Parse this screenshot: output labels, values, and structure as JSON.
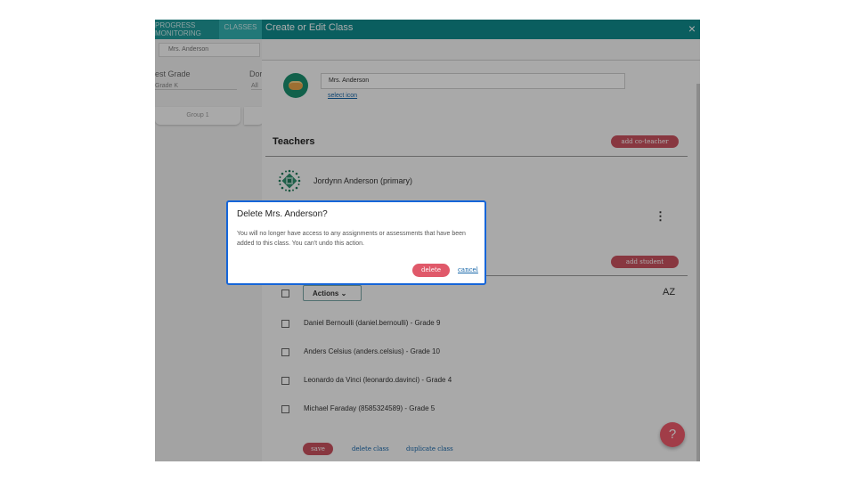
{
  "background_app": {
    "tab_progress": "PROGRESS MONITORING",
    "tab_classes": "CLASSES",
    "class_select": "Mrs. Anderson",
    "grade_label": "est Grade",
    "grade_value": "Grade K",
    "domain_label": "Dor",
    "domain_value": "All",
    "group_label": "Group 1"
  },
  "panel": {
    "title": "Create or Edit Class",
    "close_icon": "×",
    "class_name_value": "Mrs. Anderson",
    "select_icon_label": "select icon",
    "teachers_heading": "Teachers",
    "add_coteacher_label": "add co-teacher",
    "teacher_name": "Jordynn Anderson (primary)",
    "add_student_label": "add student",
    "actions_label": "Actions",
    "actions_chevron": "⌄",
    "sort_icon": "AZ",
    "students": [
      "Daniel Bernoulli (daniel.bernoulli) - Grade 9",
      "Anders Celsius (anders.celsius) - Grade 10",
      "Leonardo da Vinci (leonardo.davinci) - Grade 4",
      "Michael Faraday (8585324589) - Grade 5"
    ],
    "save_label": "save",
    "delete_class_label": "delete class",
    "duplicate_class_label": "duplicate class",
    "help_label": "?"
  },
  "dialog": {
    "title": "Delete Mrs. Anderson?",
    "body": "You will no longer have access to any assignments or assessments that have been added to this class. You can't undo this action.",
    "delete_label": "delete",
    "cancel_label": "cancel"
  },
  "colors": {
    "header_teal": "#0f8b8d",
    "accent_red": "#c9515f",
    "dialog_border": "#1565d8",
    "link_blue": "#1565a8"
  }
}
